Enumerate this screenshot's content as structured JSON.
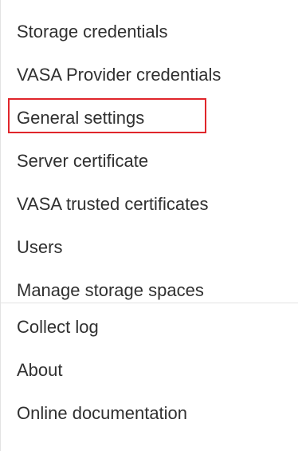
{
  "menu": {
    "items_top": [
      {
        "label": "Storage credentials"
      },
      {
        "label": "VASA Provider credentials"
      },
      {
        "label": "General settings"
      },
      {
        "label": "Server certificate"
      },
      {
        "label": "VASA trusted certificates"
      },
      {
        "label": "Users"
      },
      {
        "label": "Manage storage spaces"
      }
    ],
    "items_bottom": [
      {
        "label": "Collect log"
      },
      {
        "label": "About"
      },
      {
        "label": "Online documentation"
      }
    ],
    "highlighted_item": "General settings",
    "highlight_color": "#e0262b"
  }
}
